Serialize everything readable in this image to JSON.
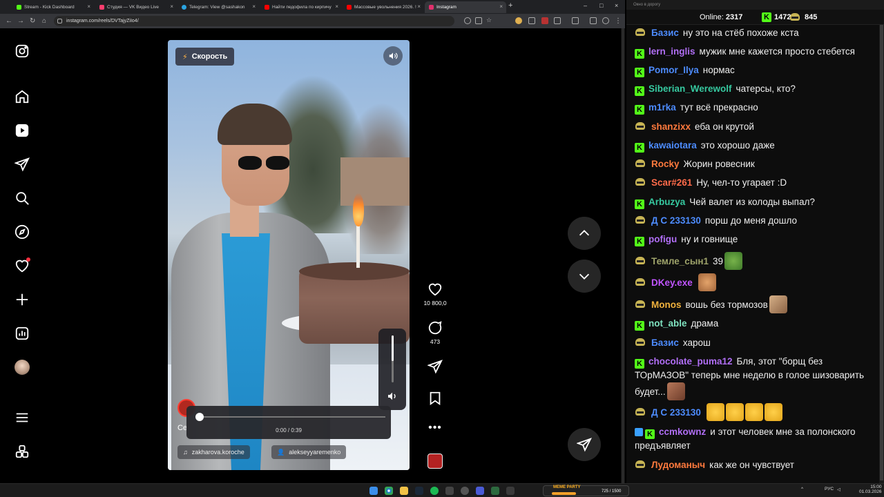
{
  "browser": {
    "tabs": [
      {
        "title": "Stream - Kick Dashboard",
        "color": "#53fc18",
        "active": false
      },
      {
        "title": "Студия — VK Видео Live",
        "color": "#ff3d6e",
        "active": false
      },
      {
        "title": "Telegram: View @sashakon",
        "color": "#2aa3e0",
        "active": false
      },
      {
        "title": "Найти педофила по кирпичу",
        "color": "#ff0000",
        "active": false
      },
      {
        "title": "Массовые увольнения 2026. !",
        "color": "#ff0000",
        "active": false
      },
      {
        "title": "Instagram",
        "color": "#e1306c",
        "active": true
      }
    ],
    "url": "instagram.com/reels/DVTajyZiIo4/"
  },
  "reel": {
    "speed_label": "Скорость",
    "caption_stub": "Се",
    "time": "0:00 / 0:39",
    "progress": 0.0,
    "volume": 0.55,
    "audio_name": "zakharova.koroche",
    "tagged_user": "alekseyyaremenko",
    "likes": "10 800,0",
    "comments": "473"
  },
  "chat": {
    "window_title": "Окно в дорогу",
    "online_label": "Online:",
    "online_count": "2317",
    "kick_count": "1472",
    "other_count": "845",
    "messages": [
      {
        "badge": "olive",
        "nick": "Базис",
        "color": "#4d8cff",
        "text": "ну это на стёб похоже кста"
      },
      {
        "badge": "kick",
        "nick": "lern_inglis",
        "color": "#b06ef5",
        "text": "мужик мне кажется просто стебется"
      },
      {
        "badge": "kick",
        "nick": "Pomor_Ilya",
        "color": "#4d8cff",
        "text": "нормас"
      },
      {
        "badge": "kick",
        "nick": "Siberian_Werewolf",
        "color": "#36c9a0",
        "text": "чатерсы, кто?"
      },
      {
        "badge": "kick",
        "nick": "m1rka",
        "color": "#4d8cff",
        "text": "тут всё прекрасно"
      },
      {
        "badge": "olive",
        "nick": "shanzixx",
        "color": "#ff7a3d",
        "text": "еба он крутой"
      },
      {
        "badge": "kick",
        "nick": "kawaiotara",
        "color": "#4d8cff",
        "text": "это хорошо даже"
      },
      {
        "badge": "olive",
        "nick": "Rocky",
        "color": "#ff7a3d",
        "text": "Жорин ровесник"
      },
      {
        "badge": "olive",
        "nick": "Scar#261",
        "color": "#ff6b4a",
        "text": "Ну, чел-то угарает :D"
      },
      {
        "badge": "kick",
        "nick": "Arbuzya",
        "color": "#36c9a0",
        "text": "Чей валет из колоды выпал?"
      },
      {
        "badge": "olive",
        "nick": "Д С 233130",
        "color": "#4d8cff",
        "text": "порш до меня дошло"
      },
      {
        "badge": "kick",
        "nick": "pofigu",
        "color": "#b06ef5",
        "text": "ну и говнище"
      },
      {
        "badge": "olive",
        "nick": "Темле_сын1",
        "color": "#9ea36a",
        "text": "39"
      },
      {
        "badge": "olive",
        "nick": "DKey.exe",
        "color": "#c054ff",
        "text": ""
      },
      {
        "badge": "olive",
        "nick": "Monos",
        "color": "#f2b33d",
        "text": "вошь без тормозов"
      },
      {
        "badge": "kick",
        "nick": "not_able",
        "color": "#7fe3c0",
        "text": "драма"
      },
      {
        "badge": "olive",
        "nick": "Базис",
        "color": "#4d8cff",
        "text": "харош"
      },
      {
        "badge": "kick",
        "nick": "chocolate_puma12",
        "color": "#b06ef5",
        "text": "Бля, этот \"борщ без ТОрМАЗОВ\" теперь мне неделю в голое шизоварить будет..."
      },
      {
        "badge": "olive",
        "nick": "Д С 233130",
        "color": "#4d8cff",
        "text": ""
      },
      {
        "badge": "kick2",
        "nick": "ccmkownz",
        "color": "#b06ef5",
        "text": "и этот человек мне за полонского предъявляет"
      },
      {
        "badge": "olive",
        "nick": "Лудоманыч",
        "color": "#ff7a3d",
        "text": "как же он чувствует"
      }
    ]
  },
  "taskbar": {
    "widget_label": "MEME PARTY",
    "widget_count": "725 / 1500",
    "lang": "РУС",
    "time": "15:00",
    "date": "01.03.2026"
  }
}
